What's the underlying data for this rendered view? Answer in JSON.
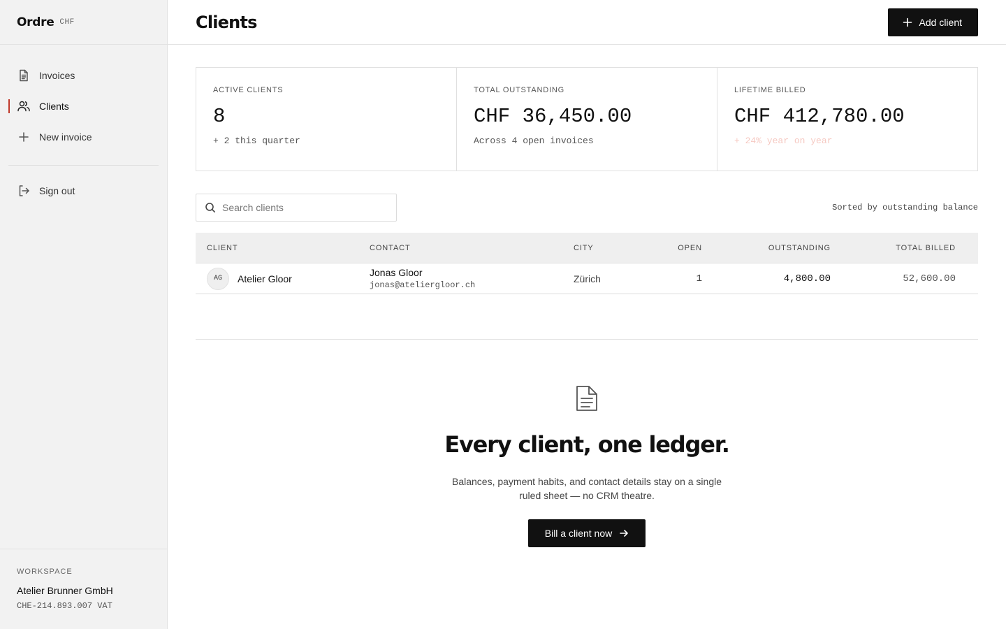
{
  "brand": {
    "name": "Ordre",
    "currency": "CHF"
  },
  "nav": {
    "items": [
      {
        "label": "Invoices",
        "icon": "document-icon"
      },
      {
        "label": "Clients",
        "icon": "users-icon",
        "active": true
      },
      {
        "label": "New invoice",
        "icon": "plus-icon"
      }
    ],
    "sign_out": "Sign out"
  },
  "workspace": {
    "label": "WORKSPACE",
    "name": "Atelier Brunner GmbH",
    "vat": "CHE-214.893.007 VAT"
  },
  "header": {
    "title": "Clients",
    "add_button": "Add client"
  },
  "stats": [
    {
      "label": "ACTIVE CLIENTS",
      "value": "8",
      "note": "+ 2 this quarter"
    },
    {
      "label": "TOTAL OUTSTANDING",
      "value": "CHF 36,450.00",
      "note": "Across 4 open invoices"
    },
    {
      "label": "LIFETIME BILLED",
      "value": "CHF 412,780.00",
      "note": "+ 24% year on year"
    }
  ],
  "search": {
    "placeholder": "Search clients",
    "value": ""
  },
  "sort_note": "Sorted by outstanding balance",
  "table": {
    "columns": [
      "CLIENT",
      "CONTACT",
      "CITY",
      "OPEN",
      "OUTSTANDING",
      "TOTAL BILLED"
    ],
    "rows": [
      {
        "initials": "AG",
        "client": "Atelier Gloor",
        "contact_name": "Jonas Gloor",
        "contact_email": "jonas@ateliergloor.ch",
        "city": "Zürich",
        "open": "1",
        "outstanding": "4,800.00",
        "total_billed": "52,600.00"
      }
    ]
  },
  "empty_state": {
    "icon": "document-icon",
    "title": "Every client, one ledger.",
    "text": "Balances, payment habits, and contact details stay on a single ruled sheet — no CRM theatre.",
    "cta": "Bill a client now"
  },
  "colors": {
    "accent": "#c0392b",
    "dark_button": "#111111",
    "sidebar_bg": "#f2f2f2"
  }
}
